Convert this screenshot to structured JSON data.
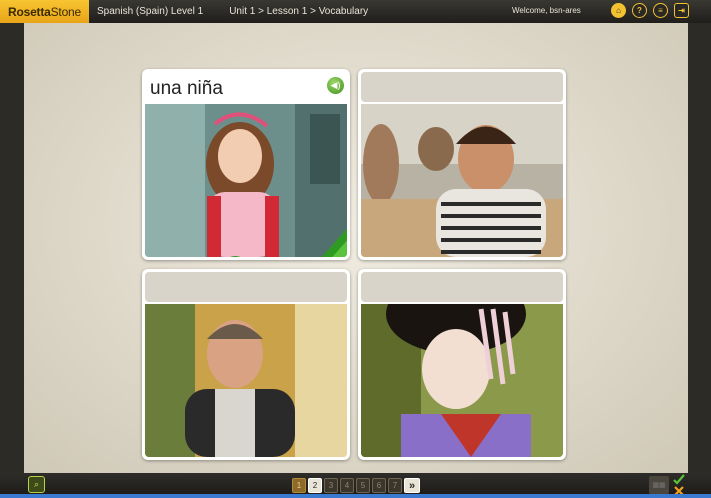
{
  "header": {
    "logo_bold": "Rosetta",
    "logo_light": "Stone",
    "course": "Spanish (Spain) Level 1",
    "breadcrumb": "Unit 1 > Lesson 1 > Vocabulary",
    "welcome": "Welcome, bsn-ares",
    "icons": [
      "home-icon",
      "help-icon",
      "menu-icon",
      "exit-icon"
    ]
  },
  "cards": [
    {
      "label": "una niña",
      "state": "correct",
      "photo": "girl-photo"
    },
    {
      "label": "",
      "state": "blank",
      "photo": "boy-photo"
    },
    {
      "label": "",
      "state": "blank",
      "photo": "man-photo"
    },
    {
      "label": "",
      "state": "blank",
      "photo": "woman-photo"
    }
  ],
  "pager": {
    "pages": [
      "1",
      "2",
      "3",
      "4",
      "5",
      "6",
      "7"
    ],
    "current": "2",
    "next_label": "»"
  },
  "colors": {
    "accent": "#f2c230",
    "correct": "#3aa52a",
    "stage": "#e6e1d4"
  }
}
